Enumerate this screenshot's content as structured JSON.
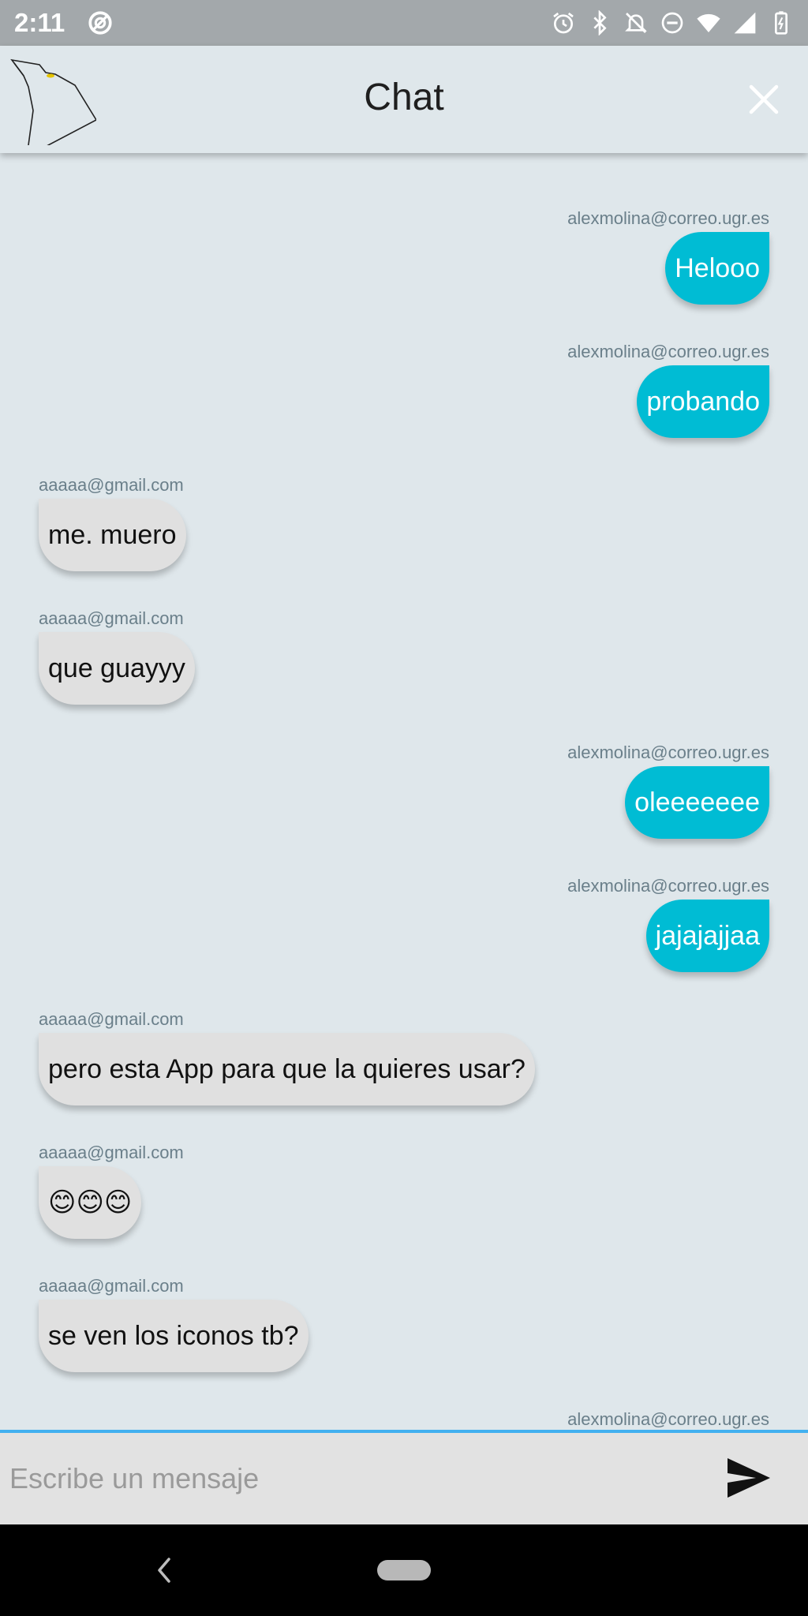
{
  "status_bar": {
    "time": "2:11"
  },
  "app_bar": {
    "title": "Chat"
  },
  "messages": [
    {
      "sender": "alexmolina@correo.ugr.es",
      "text": "Helooo",
      "mine": true
    },
    {
      "sender": "alexmolina@correo.ugr.es",
      "text": "probando",
      "mine": true
    },
    {
      "sender": "aaaaa@gmail.com",
      "text": "me. muero",
      "mine": false
    },
    {
      "sender": "aaaaa@gmail.com",
      "text": "que guayyy",
      "mine": false
    },
    {
      "sender": "alexmolina@correo.ugr.es",
      "text": "oleeeeeee",
      "mine": true
    },
    {
      "sender": "alexmolina@correo.ugr.es",
      "text": "jajajajjaa",
      "mine": true
    },
    {
      "sender": "aaaaa@gmail.com",
      "text": "pero esta App para que la quieres usar?",
      "mine": false
    },
    {
      "sender": "aaaaa@gmail.com",
      "text": "😊😊😊",
      "mine": false
    },
    {
      "sender": "aaaaa@gmail.com",
      "text": "se ven los iconos tb?",
      "mine": false
    },
    {
      "sender": "alexmolina@correo.ugr.es",
      "text": "",
      "mine": true
    }
  ],
  "composer": {
    "placeholder": "Escribe un mensaje",
    "value": ""
  },
  "colors": {
    "own_bubble": "#00bcd4",
    "other_bubble": "#e0e0e0",
    "background": "#dfe7eb",
    "input_border": "#42b0f0"
  },
  "icons": {
    "close": "close-icon",
    "send": "send-icon",
    "back": "back-icon",
    "home": "home-pill"
  }
}
